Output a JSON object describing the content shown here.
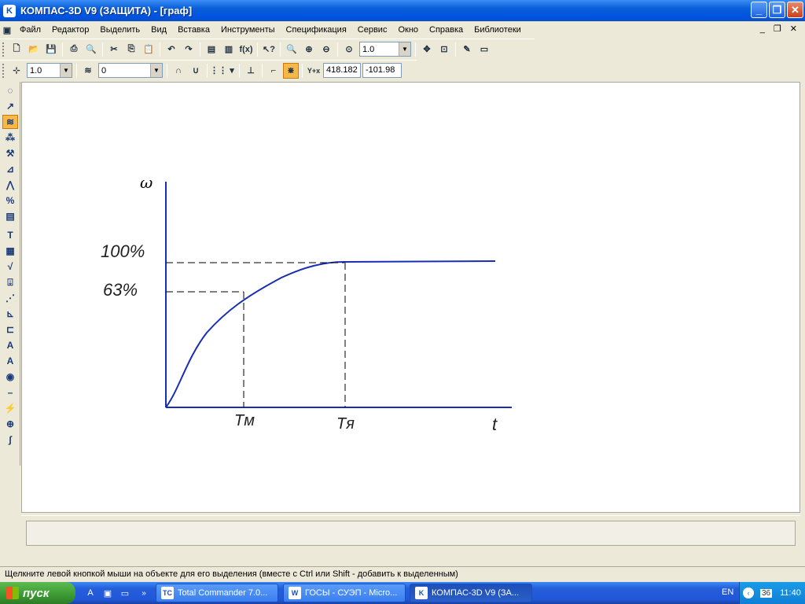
{
  "window": {
    "title": "КОМПАС-3D V9 (ЗАЩИТА) - [граф]",
    "app_icon": "kompas-icon"
  },
  "menu": [
    "Файл",
    "Редактор",
    "Выделить",
    "Вид",
    "Вставка",
    "Инструменты",
    "Спецификация",
    "Сервис",
    "Окно",
    "Справка",
    "Библиотеки"
  ],
  "toolbar1": {
    "zoom_value": "1.0"
  },
  "toolbar2": {
    "line_style_value": "1.0",
    "layer_value": "0",
    "coord_x": "418.182",
    "coord_y": "-101.98",
    "coord_axis_label": "Y+x"
  },
  "graph": {
    "y_axis_label": "ω",
    "x_axis_label": "t",
    "label_100": "100%",
    "label_63": "63%",
    "label_tm": "Tм",
    "label_tya": "Tя"
  },
  "status": {
    "hint": "Щелкните левой кнопкой мыши на объекте для его выделения (вместе с Ctrl или Shift - добавить к выделенным)"
  },
  "taskbar": {
    "start_label": "пуск",
    "tasks": [
      {
        "label": "Total Commander 7.0...",
        "icon": "TC"
      },
      {
        "label": "ГОСЫ - СУЭП - Micro...",
        "icon": "W"
      },
      {
        "label": "КОМПАС-3D V9 (ЗА...",
        "icon": "K"
      }
    ],
    "lang": "EN",
    "clock": "11:40"
  },
  "colors": {
    "curve": "#1a2fb0",
    "accent": "#0053e1"
  }
}
